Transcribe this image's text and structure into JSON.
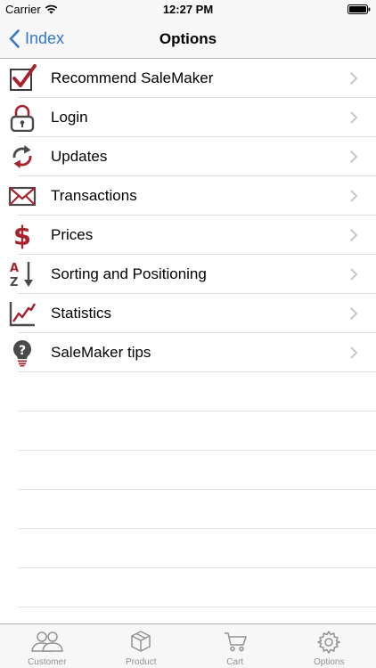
{
  "status_bar": {
    "carrier": "Carrier",
    "time": "12:27 PM"
  },
  "nav": {
    "back_label": "Index",
    "title": "Options"
  },
  "options": [
    {
      "label": "Recommend SaleMaker",
      "icon": "checkbox-check-icon"
    },
    {
      "label": "Login",
      "icon": "padlock-icon"
    },
    {
      "label": "Updates",
      "icon": "refresh-arrows-icon"
    },
    {
      "label": "Transactions",
      "icon": "envelope-icon"
    },
    {
      "label": "Prices",
      "icon": "dollar-sign-icon"
    },
    {
      "label": "Sorting and Positioning",
      "icon": "sort-az-icon"
    },
    {
      "label": "Statistics",
      "icon": "line-chart-icon"
    },
    {
      "label": "SaleMaker tips",
      "icon": "lightbulb-question-icon"
    }
  ],
  "tab_bar": {
    "tabs": [
      {
        "label": "Customer",
        "icon": "customers-icon"
      },
      {
        "label": "Product",
        "icon": "box-icon"
      },
      {
        "label": "Cart",
        "icon": "cart-icon"
      },
      {
        "label": "Options",
        "icon": "gear-icon"
      }
    ]
  },
  "colors": {
    "accent": "#3478c6",
    "icon_red": "#a7232e",
    "icon_gray": "#555555",
    "tab_gray": "#929292"
  }
}
